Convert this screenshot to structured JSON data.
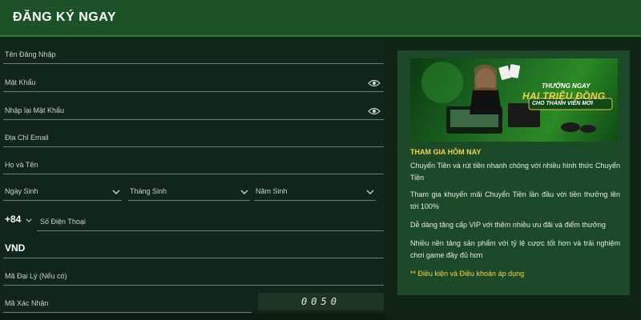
{
  "header": {
    "title": "ĐĂNG KÝ NGAY"
  },
  "form": {
    "username_label": "Tên Đăng Nhập",
    "password_label": "Mật Khẩu",
    "confirm_password_label": "Nhập lại Mật Khẩu",
    "email_label": "Địa Chỉ Email",
    "fullname_label": "Họ và Tên",
    "birth_day_label": "Ngày Sinh",
    "birth_month_label": "Tháng Sinh",
    "birth_year_label": "Năm Sinh",
    "country_code": "+84",
    "phone_label": "Số Điện Thoại",
    "currency": "VND",
    "agent_code_label": "Mã Đại Lý (Nếu có)",
    "verification_label": "Mã Xác Nhận",
    "verification_code": "0050"
  },
  "promo": {
    "banner": {
      "line1": "THƯỞNG NGAY",
      "line2": "HAI TRIỆU ĐỒNG",
      "line3": "CHO THÀNH VIÊN MỚI"
    },
    "heading": "THAM GIA HÔM NAY",
    "paragraphs": [
      "Chuyển Tiền và rút tiền nhanh chóng với nhiều hình thức Chuyển Tiền",
      "Tham gia khuyến mãi Chuyển Tiền lần đầu với tiền thưởng lên tới 100%",
      "Dễ dàng tăng cấp VIP với thêm nhiều ưu đãi và điểm thưởng",
      "Nhiều nền tảng sản phẩm với tỷ lệ cược tốt hơn và trải nghiệm chơi game đầy đủ hơn"
    ],
    "terms": "** Điều kiện và Điều khoản áp dụng"
  },
  "colors": {
    "header": "#1d5228",
    "background": "#0f2415",
    "panel": "#1c4a28",
    "accent_gold": "#f3d34a"
  }
}
